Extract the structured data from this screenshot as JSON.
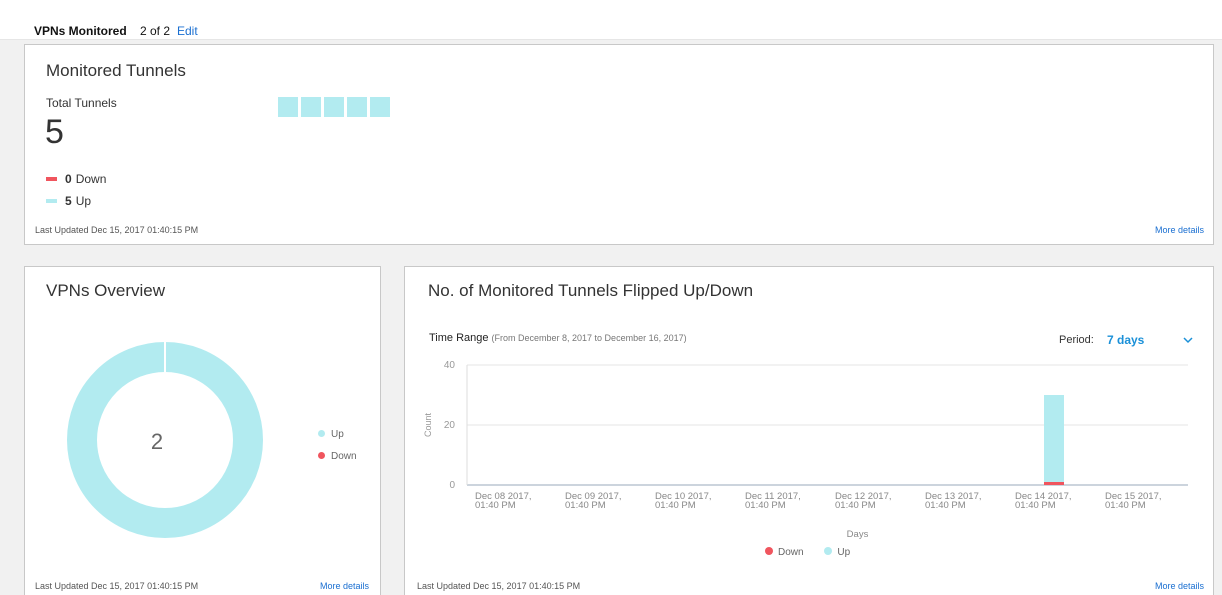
{
  "topbar": {
    "title": "VPNs Monitored",
    "count": "2 of 2",
    "edit_label": "Edit"
  },
  "colors": {
    "up": "#b2ebf0",
    "down": "#f0555e",
    "link": "#1a6fd1",
    "accent": "#1a90d8"
  },
  "tunnels": {
    "title": "Monitored Tunnels",
    "total_label": "Total Tunnels",
    "total_value": "5",
    "down_count": "0",
    "down_label": "Down",
    "up_count": "5",
    "up_label": "Up",
    "squares": [
      "up",
      "up",
      "up",
      "up",
      "up"
    ],
    "last_updated": "Last Updated Dec 15, 2017 01:40:15 PM",
    "more_details": "More details"
  },
  "vpns": {
    "title": "VPNs Overview",
    "center_value": "2",
    "legend_up": "Up",
    "legend_down": "Down",
    "donut": [
      {
        "label": "Up",
        "value": 2
      },
      {
        "label": "Down",
        "value": 0
      }
    ],
    "last_updated": "Last Updated Dec 15, 2017 01:40:15 PM",
    "more_details": "More details"
  },
  "flips": {
    "title": "No. of Monitored Tunnels Flipped Up/Down",
    "time_range_label": "Time Range",
    "time_range_sub": "(From December 8, 2017 to December 16, 2017)",
    "period_label": "Period:",
    "period_value": "7 days",
    "legend_down": "Down",
    "legend_up": "Up",
    "last_updated": "Last Updated Dec 15, 2017 01:40:15 PM",
    "more_details": "More details"
  },
  "chart_data": {
    "type": "bar",
    "stacked": true,
    "xlabel": "Days",
    "ylabel": "Count",
    "ylim": [
      0,
      40
    ],
    "yticks": [
      0,
      20,
      40
    ],
    "categories": [
      [
        "Dec 08 2017,",
        "01:40 PM"
      ],
      [
        "Dec 09 2017,",
        "01:40 PM"
      ],
      [
        "Dec 10 2017,",
        "01:40 PM"
      ],
      [
        "Dec 11 2017,",
        "01:40 PM"
      ],
      [
        "Dec 12 2017,",
        "01:40 PM"
      ],
      [
        "Dec 13 2017,",
        "01:40 PM"
      ],
      [
        "Dec 14 2017,",
        "01:40 PM"
      ],
      [
        "Dec 15 2017,",
        "01:40 PM"
      ]
    ],
    "series": [
      {
        "name": "Down",
        "values": [
          0,
          0,
          0,
          0,
          0,
          0,
          1,
          0
        ]
      },
      {
        "name": "Up",
        "values": [
          0,
          0,
          0,
          0,
          0,
          0,
          29,
          0
        ]
      }
    ],
    "grid": true,
    "legend": "bottom"
  }
}
